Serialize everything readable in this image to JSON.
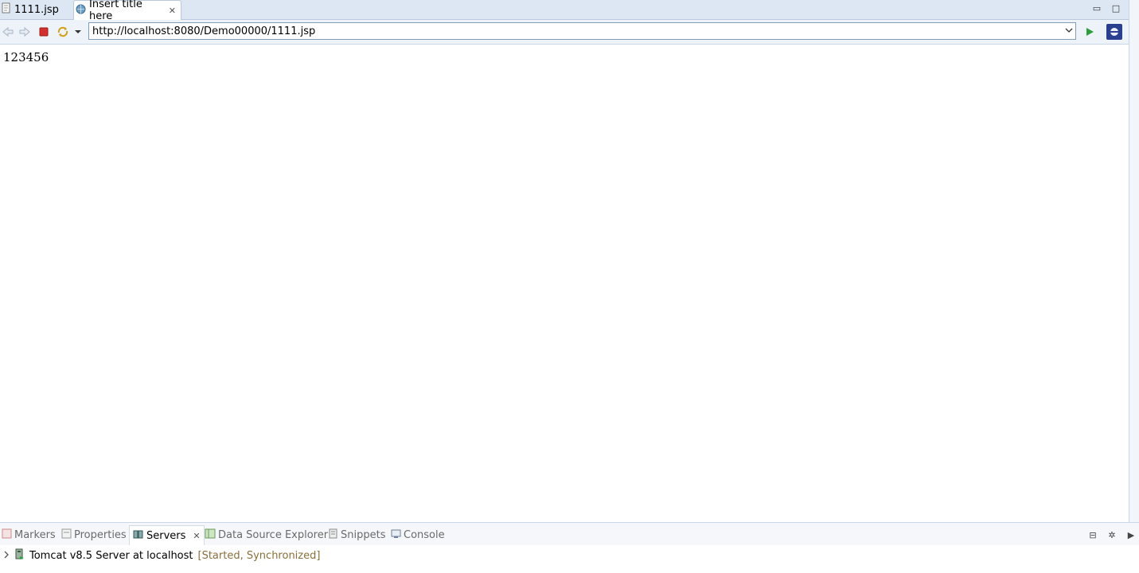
{
  "editor_tabs": [
    {
      "label": "1111.jsp",
      "icon": "jsp-file-icon"
    },
    {
      "label": "Insert title here",
      "icon": "globe-icon",
      "close": "✕"
    }
  ],
  "browser": {
    "url": "http://localhost:8080/Demo00000/1111.jsp",
    "page_text": "123456"
  },
  "bottom_panel": {
    "tabs": [
      "Markers",
      "Properties",
      "Servers",
      "Data Source Explorer",
      "Snippets",
      "Console"
    ],
    "active_tab": "Servers",
    "server": {
      "name": "Tomcat v8.5 Server at localhost",
      "status": "[Started, Synchronized]"
    }
  },
  "colors": {
    "accent": "#3a7bd5",
    "stop_red": "#d32f2f",
    "go_green": "#2e9e3f"
  }
}
